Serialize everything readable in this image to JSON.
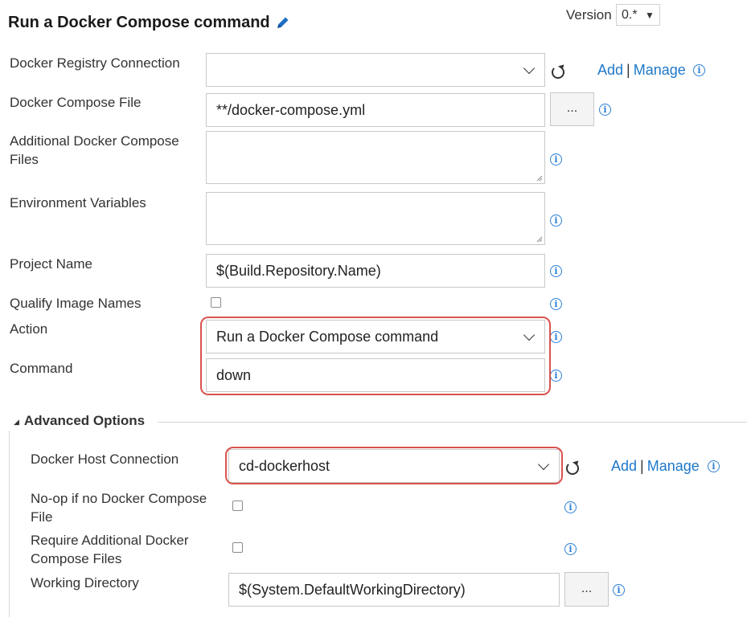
{
  "header": {
    "title": "Run a Docker Compose command",
    "version_label": "Version",
    "version_value": "0.*"
  },
  "fields": {
    "registry_connection": {
      "label": "Docker Registry Connection",
      "value": "",
      "add": "Add",
      "manage": "Manage"
    },
    "compose_file": {
      "label": "Docker Compose File",
      "value": "**/docker-compose.yml",
      "browse": "..."
    },
    "additional_files": {
      "label_line1": "Additional Docker Compose",
      "label_line2": "Files",
      "value": ""
    },
    "env_variables": {
      "label": "Environment Variables",
      "value": ""
    },
    "project_name": {
      "label": "Project Name",
      "value": "$(Build.Repository.Name)"
    },
    "qualify_images": {
      "label": "Qualify Image Names",
      "checked": false
    },
    "action": {
      "label": "Action",
      "value": "Run a Docker Compose command"
    },
    "command": {
      "label": "Command",
      "value": "down"
    }
  },
  "advanced": {
    "title": "Advanced Options",
    "host_connection": {
      "label": "Docker Host Connection",
      "value": "cd-dockerhost",
      "add": "Add",
      "manage": "Manage"
    },
    "noop": {
      "label_line1": "No-op if no Docker Compose",
      "label_line2": "File",
      "checked": false
    },
    "require_additional": {
      "label_line1": "Require Additional Docker",
      "label_line2": "Compose Files",
      "checked": false
    },
    "working_dir": {
      "label": "Working Directory",
      "value": "$(System.DefaultWorkingDirectory)",
      "browse": "..."
    }
  },
  "colors": {
    "link": "#1e78c8",
    "highlight": "#d9534f",
    "info": "#2b7fd4"
  },
  "icons": [
    "pencil-icon",
    "refresh-icon",
    "info-icon",
    "chevron-down-icon",
    "collapse-triangle-icon"
  ]
}
